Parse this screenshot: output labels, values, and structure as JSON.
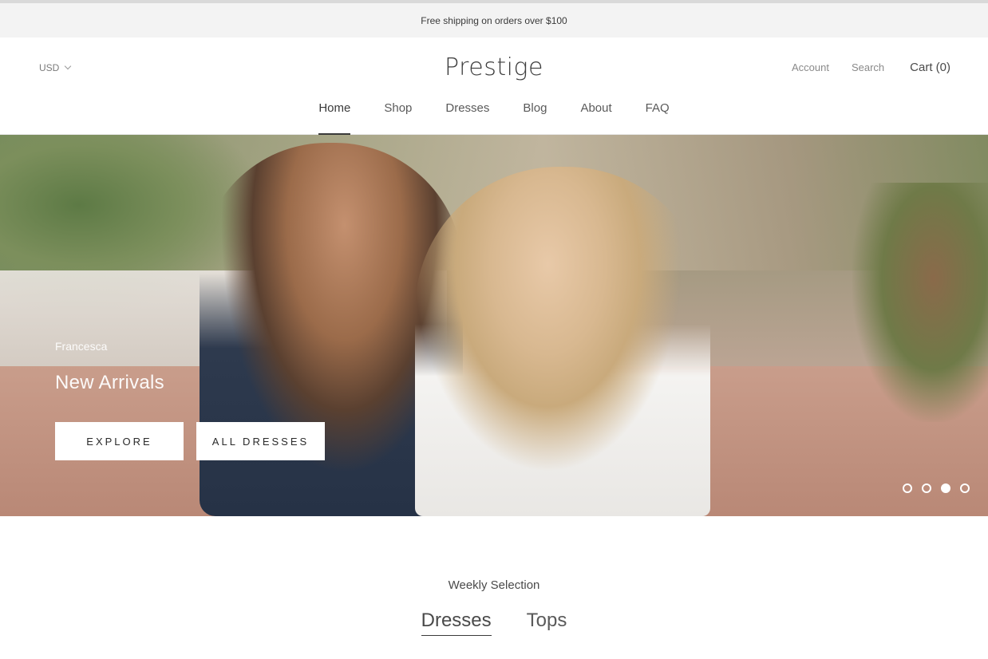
{
  "announcement": {
    "text": "Free shipping on orders over $100"
  },
  "header": {
    "currency": "USD",
    "logo": "Prestige",
    "account_label": "Account",
    "search_label": "Search",
    "cart_label": "Cart (0)"
  },
  "nav": {
    "items": [
      "Home",
      "Shop",
      "Dresses",
      "Blog",
      "About",
      "FAQ"
    ],
    "active": "Home"
  },
  "hero": {
    "subheading": "Francesca",
    "title": "New Arrivals",
    "buttons": [
      "EXPLORE",
      "ALL DRESSES"
    ],
    "slide_count": 4,
    "active_slide": 3
  },
  "collection": {
    "heading": "Weekly Selection",
    "tabs": [
      "Dresses",
      "Tops"
    ],
    "active_tab": "Dresses"
  },
  "colors": {
    "announcement_bg": "#f3f3f3",
    "text": "#333333",
    "button_bg": "#ffffff"
  }
}
